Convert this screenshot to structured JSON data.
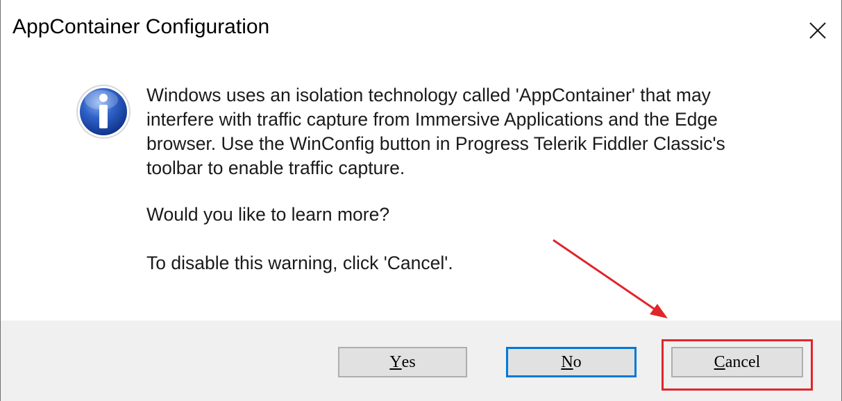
{
  "window": {
    "title": "AppContainer Configuration",
    "close_icon": "close-icon"
  },
  "message": {
    "icon": "info-icon",
    "lines": [
      "Windows uses an isolation technology called 'AppContainer' that may",
      "interfere with traffic capture from Immersive Applications and the Edge",
      "browser. Use the WinConfig button in Progress Telerik Fiddler Classic's",
      "toolbar to enable traffic capture."
    ],
    "question": "Would you like to learn more?",
    "disable_hint": "To disable this warning, click 'Cancel'."
  },
  "buttons": {
    "yes": {
      "mnemonic": "Y",
      "rest": "es"
    },
    "no": {
      "mnemonic": "N",
      "rest": "o"
    },
    "cancel": {
      "mnemonic": "C",
      "rest": "ancel"
    }
  },
  "colors": {
    "annotation": "#e0252b",
    "focus_border": "#0078d7",
    "button_bar": "#f0f0f0"
  }
}
